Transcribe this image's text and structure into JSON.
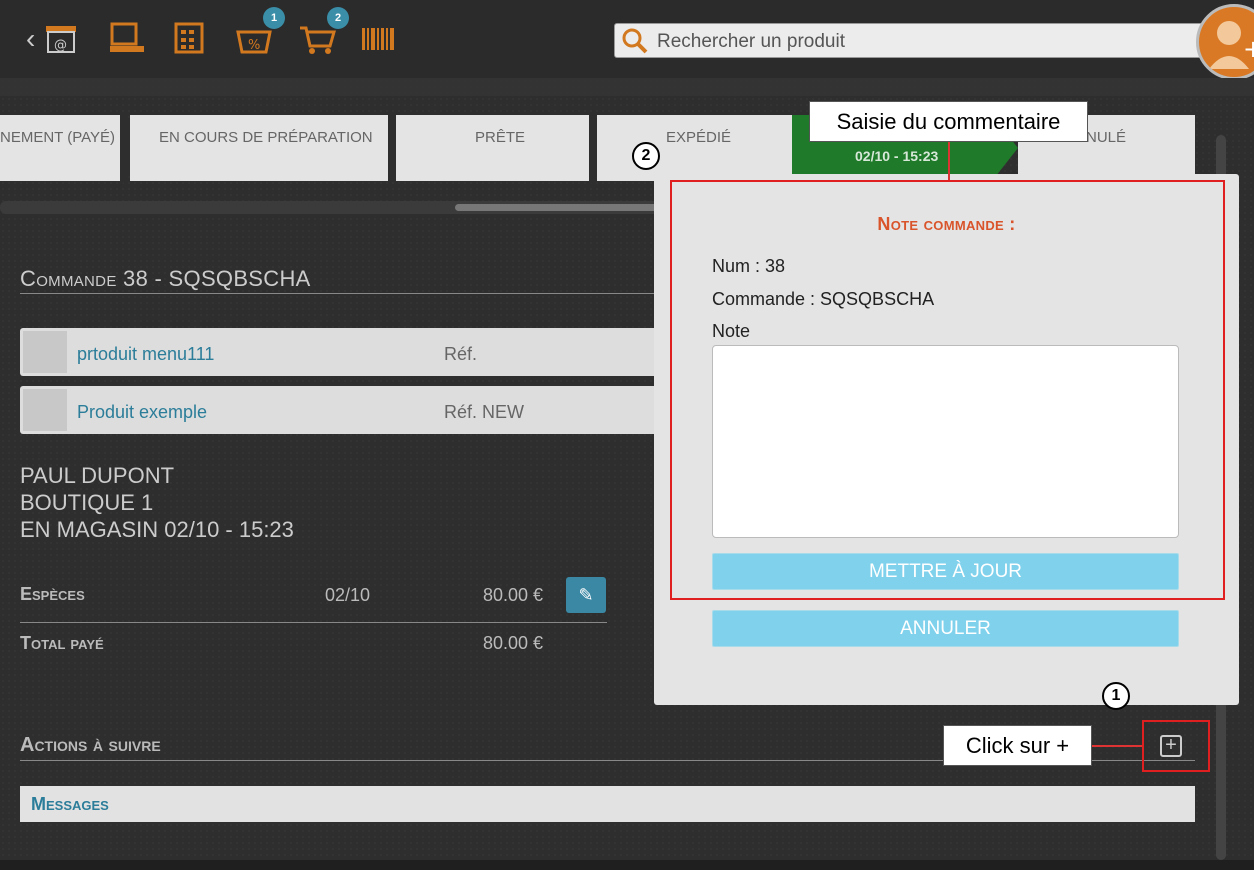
{
  "topbar": {
    "badges": [
      "1",
      "2"
    ],
    "search_placeholder": "Rechercher un produit",
    "icons": [
      "back-web-store-icon",
      "pos-terminal-icon",
      "calculator-icon",
      "promo-basket-icon",
      "cart-icon",
      "barcode-icon",
      "search-icon",
      "user-add-icon"
    ]
  },
  "pipeline": {
    "steps": [
      {
        "label": "NEMENT (PAYÉ)"
      },
      {
        "label": "EN COURS DE PRÉPARATION"
      },
      {
        "label": "PRÊTE"
      },
      {
        "label": "EXPÉDIÉ"
      },
      {
        "label": "02/10 - 15:23"
      },
      {
        "label": "NULÉ"
      }
    ]
  },
  "order": {
    "title": "Commande 38 - SQSQBSCHA",
    "products": [
      {
        "name": "prtoduit menu111",
        "ref": "Réf."
      },
      {
        "name": "Produit exemple",
        "ref": "Réf. NEW"
      }
    ],
    "customer": [
      "PAUL DUPONT",
      "BOUTIQUE 1",
      "EN MAGASIN 02/10 - 15:23"
    ],
    "payment": {
      "label": "Espèces",
      "date": "02/10",
      "amount": "80.00 €"
    },
    "total": {
      "label": "Total payé",
      "amount": "80.00 €"
    },
    "actions_title": "Actions à suivre",
    "messages_label": "Messages"
  },
  "modal": {
    "title": "Note commande :",
    "num": "Num : 38",
    "commande": "Commande : SQSQBSCHA",
    "note_label": "Note",
    "note_value": "",
    "update_button": "METTRE À JOUR",
    "cancel_button": "ANNULER"
  },
  "annotations": {
    "callout_comment": "Saisie du commentaire",
    "callout_click": "Click sur +",
    "marker_1": "1",
    "marker_2": "2"
  },
  "colors": {
    "accent_orange": "#d2781f",
    "link_blue": "#2b7d99",
    "button_light_blue": "#7fd1ec",
    "active_step_green": "#1f7a2a",
    "annotation_red": "#e02020"
  }
}
